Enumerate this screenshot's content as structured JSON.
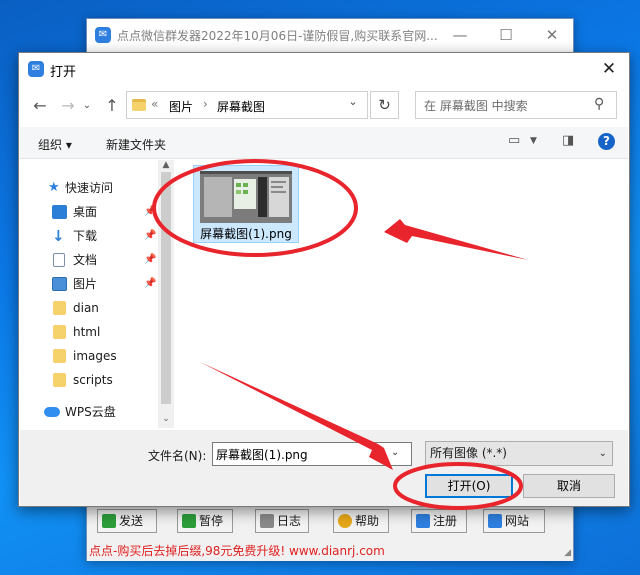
{
  "background_app": {
    "title": "点点微信群发器2022年10月06日-谨防假冒,购买联系官网...",
    "controls": {
      "minimize": "—",
      "maximize": "☐",
      "close": "✕"
    },
    "toolbar": [
      {
        "label": "发送",
        "icon": "play-icon",
        "color": "#2e9e3a"
      },
      {
        "label": "暂停",
        "icon": "pause-icon",
        "color": "#2e9e3a"
      },
      {
        "label": "日志",
        "icon": "log-icon",
        "color": "#8a8a8a"
      },
      {
        "label": "帮助",
        "icon": "help-icon",
        "color": "#e6a817"
      },
      {
        "label": "注册",
        "icon": "register-icon",
        "color": "#2f7fe0"
      },
      {
        "label": "网站",
        "icon": "home-icon",
        "color": "#2f7fe0"
      }
    ],
    "footer": "点点-购买后去掉后缀,98元免费升级! www.dianrj.com"
  },
  "dialog": {
    "title": "打开",
    "close": "✕",
    "address": {
      "prefix": "«",
      "crumbs": [
        "图片",
        "屏幕截图"
      ],
      "separator": "›"
    },
    "search": {
      "placeholder": "在 屏幕截图 中搜索"
    },
    "commands": {
      "organize": "组织 ▾",
      "new_folder": "新建文件夹",
      "help": "?"
    },
    "nav_items": [
      {
        "label": "快速访问",
        "icon": "star-icon",
        "color": "#2f7fe0",
        "pinned": false
      },
      {
        "label": "桌面",
        "icon": "desktop-icon",
        "color": "#2b7fd6",
        "pinned": true
      },
      {
        "label": "下载",
        "icon": "download-icon",
        "color": "#2b7fd6",
        "pinned": true
      },
      {
        "label": "文档",
        "icon": "document-icon",
        "color": "#7d8fa8",
        "pinned": true
      },
      {
        "label": "图片",
        "icon": "pictures-icon",
        "color": "#4a90d9",
        "pinned": true
      },
      {
        "label": "dian",
        "icon": "folder-icon",
        "color": "#f5d26b",
        "pinned": false
      },
      {
        "label": "html",
        "icon": "folder-icon",
        "color": "#f5d26b",
        "pinned": false
      },
      {
        "label": "images",
        "icon": "folder-icon",
        "color": "#f5d26b",
        "pinned": false
      },
      {
        "label": "scripts",
        "icon": "folder-icon",
        "color": "#f5d26b",
        "pinned": false
      },
      {
        "label": "WPS云盘",
        "icon": "cloud-icon",
        "color": "#2f8ef0",
        "pinned": false
      }
    ],
    "files": [
      {
        "name": "屏幕截图(1).png",
        "selected": true
      }
    ],
    "filename_label": "文件名(N):",
    "filename_value": "屏幕截图(1).png",
    "file_type": "所有图像 (*.*)",
    "open_button": "打开(O)",
    "cancel_button": "取消"
  },
  "annotation_color": "#e8242c"
}
